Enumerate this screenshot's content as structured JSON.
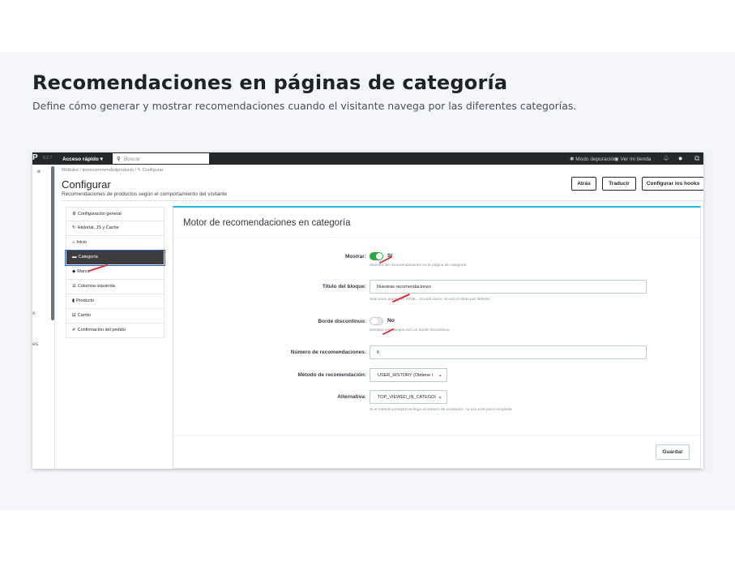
{
  "page": {
    "title": "Recomendaciones en páginas de categoría",
    "subtitle": "Define cómo generar y mostrar recomendaciones cuando el visitante navega por las diferentes categorías."
  },
  "topbar": {
    "logo": "P",
    "version": "8.2.7",
    "quick_access": "Acceso rápido ▾",
    "search_placeholder": "Buscar",
    "debug_mode": "Modo depuración",
    "view_store": "Ver mi tienda"
  },
  "sidenav": {
    "collapse": "«",
    "partial1": "o",
    "partial2": "es"
  },
  "header": {
    "breadcrumb": "Módulos  /  tpsrecommendedproducts  /  ✎ Configurar",
    "title": "Configurar",
    "description": "Recomendaciones de productos según el comportamiento del visitante",
    "buttons": {
      "back": "Atrás",
      "translate": "Traducir",
      "hooks": "Configurar los hooks"
    }
  },
  "menu": {
    "items": [
      {
        "icon": "⚙",
        "label": "Configuración general"
      },
      {
        "icon": "↻",
        "label": "Historial, JS y Cache"
      },
      {
        "icon": "⌂",
        "label": "Inicio"
      },
      {
        "icon": "▬",
        "label": "Categoría"
      },
      {
        "icon": "◆",
        "label": "Marca"
      },
      {
        "icon": "☰",
        "label": "Columna izquierda"
      },
      {
        "icon": "▮",
        "label": "Producto"
      },
      {
        "icon": "⊟",
        "label": "Carrito"
      },
      {
        "icon": "✔",
        "label": "Confirmación del pedido"
      }
    ],
    "active_index": 3
  },
  "form": {
    "title": "Motor de recomendaciones en categoría",
    "show": {
      "label": "Mostrar:",
      "value": "Sí",
      "on": true,
      "help": "Muestra las recomendaciones en la página de categoría"
    },
    "block_title": {
      "label": "Título del bloque:",
      "value": "Nuestras recomendaciones",
      "help": "Solo texto plano, sin HTML.. Si está vacío, se usa el título por defecto."
    },
    "dashed_border": {
      "label": "Borde discontinuo:",
      "value": "No",
      "on": false,
      "help": "Destaca este bloque con un borde discontinuo."
    },
    "count": {
      "label": "Número de recomendaciones:",
      "value": "6"
    },
    "method": {
      "label": "Método de recomendación:",
      "value": "USER_HISTORY (Obtiene ɾ"
    },
    "alternative": {
      "label": "Alternativa:",
      "value": "TOP_VIEWED_IN_CATEGOI",
      "help": "Si el método principal no llega al número de productos, se usa este para completar"
    },
    "save": "Guardar"
  },
  "colors": {
    "accent": "#25b9d7",
    "toggle_on": "#28a745",
    "annotation": "#e0252c",
    "dark": "#25282b"
  }
}
